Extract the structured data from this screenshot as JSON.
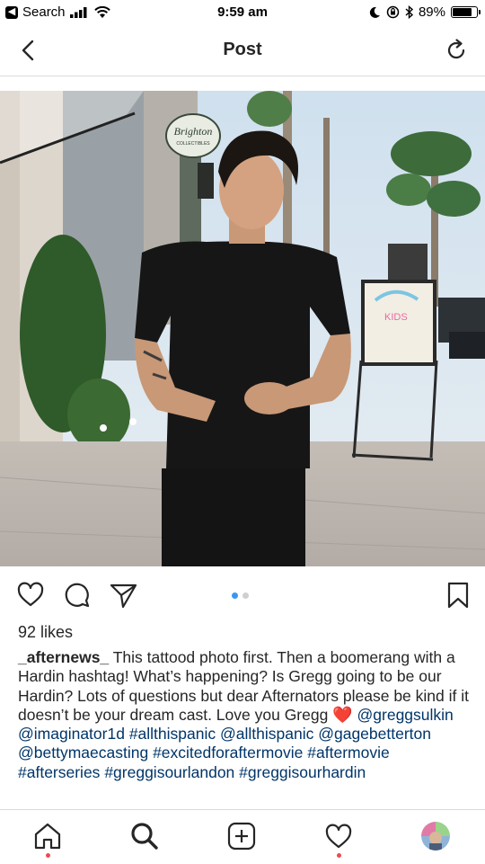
{
  "status_bar": {
    "back_app": "Search",
    "time": "9:59 am",
    "battery_percent": "89%",
    "battery_level": 0.89
  },
  "nav": {
    "title": "Post"
  },
  "photo": {
    "sign_text": "Brighton",
    "sign_subtext": "COLLECTIBLES",
    "kiosk_text": "KIDS"
  },
  "actions": {
    "carousel_pages": 2,
    "carousel_active": 1
  },
  "likes": "92 likes",
  "caption": {
    "username": "_afternews_",
    "text": "This tattood photo first. Then a boomerang with a  Hardin hashtag! What’s happening? Is Gregg going to be our Hardin? Lots of questions but dear Afternators please be kind if it doesn’t be your dream cast. Love you Gregg",
    "heart": "❤️",
    "mentions": [
      "@greggsulkin",
      "@imaginator1d",
      "@allthispanic",
      "@gagebetterton",
      "@bettymaecasting"
    ],
    "hashtags": [
      "#allthispanic",
      "#excitedforaftermovie",
      "#aftermovie",
      "#afterseries",
      "#greggisourlandon",
      "#greggisourhardin"
    ]
  },
  "tab_bar": {
    "items": [
      "home-icon",
      "search-icon",
      "new-post-icon",
      "activity-heart-icon",
      "profile-avatar"
    ]
  },
  "colors": {
    "link": "#003569",
    "accent": "#3897f0",
    "notification": "#ed4956"
  }
}
